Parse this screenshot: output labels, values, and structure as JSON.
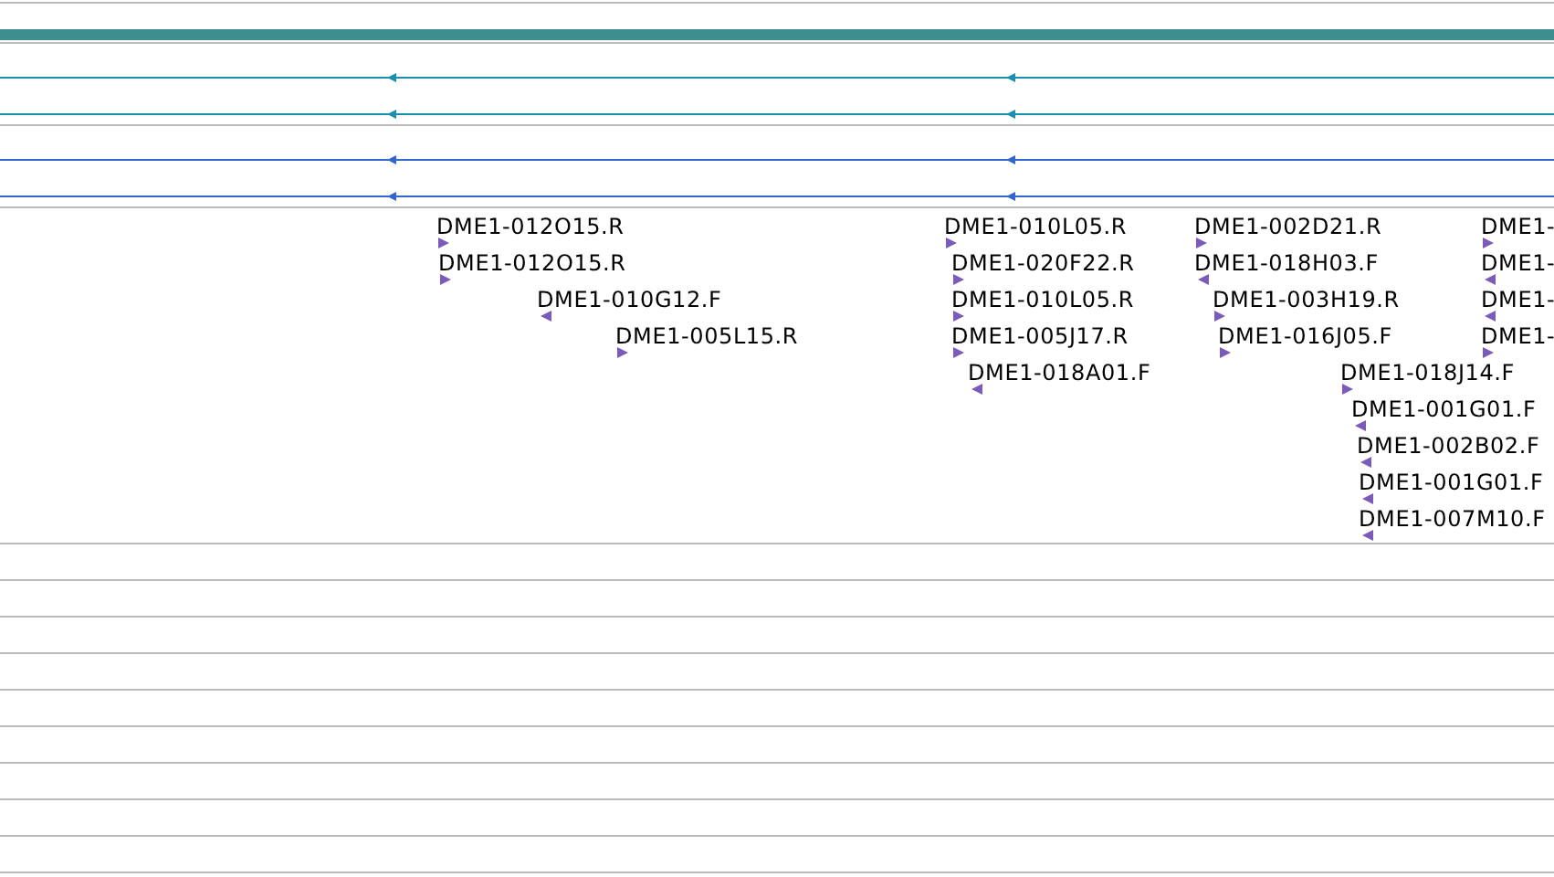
{
  "alignment_tracks": [
    {
      "color": "#1a8fb0",
      "lines": [
        {
          "reverse_strand": true
        },
        {
          "reverse_strand": true
        }
      ]
    },
    {
      "color": "#3366cc",
      "lines": [
        {
          "reverse_strand": true
        },
        {
          "reverse_strand": true
        }
      ]
    }
  ],
  "features": [
    {
      "label": "DME1-012O15.R",
      "reverse_strand": false
    },
    {
      "label": "DME1-010L05.R",
      "reverse_strand": false
    },
    {
      "label": "DME1-002D21.R",
      "reverse_strand": false
    },
    {
      "label": "DME1-",
      "reverse_strand": false
    },
    {
      "label": "DME1-012O15.R",
      "reverse_strand": false
    },
    {
      "label": "DME1-020F22.R",
      "reverse_strand": false
    },
    {
      "label": "DME1-018H03.F",
      "reverse_strand": true
    },
    {
      "label": "DME1-",
      "reverse_strand": true
    },
    {
      "label": "DME1-010G12.F",
      "reverse_strand": true
    },
    {
      "label": "DME1-010L05.R",
      "reverse_strand": false
    },
    {
      "label": "DME1-003H19.R",
      "reverse_strand": false
    },
    {
      "label": "DME1-",
      "reverse_strand": true
    },
    {
      "label": "DME1-005L15.R",
      "reverse_strand": false
    },
    {
      "label": "DME1-005J17.R",
      "reverse_strand": false
    },
    {
      "label": "DME1-016J05.F",
      "reverse_strand": false
    },
    {
      "label": "DME1-",
      "reverse_strand": false
    },
    {
      "label": "DME1-018A01.F",
      "reverse_strand": true
    },
    {
      "label": "DME1-018J14.F",
      "reverse_strand": false
    },
    {
      "label": "DME1-001G01.F",
      "reverse_strand": true
    },
    {
      "label": "DME1-002B02.F",
      "reverse_strand": true
    },
    {
      "label": "DME1-001G01.F",
      "reverse_strand": true
    },
    {
      "label": "DME1-007M10.F",
      "reverse_strand": true
    }
  ]
}
